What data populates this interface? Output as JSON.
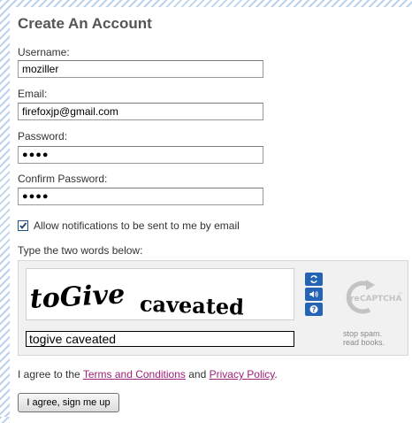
{
  "form": {
    "title": "Create An Account",
    "username_label": "Username:",
    "username_value": "moziller",
    "email_label": "Email:",
    "email_value": "firefoxjp@gmail.com",
    "password_label": "Password:",
    "password_value": "●●●●",
    "confirm_label": "Confirm Password:",
    "confirm_value": "●●●●",
    "notify_label": "Allow notifications to be sent to me by email",
    "notify_checked": true
  },
  "captcha": {
    "prompt": "Type the two words below:",
    "word1": "toGive",
    "word2": "caveated",
    "input_value": "togive caveated",
    "logo_re": "re",
    "logo_text": "CAPTCHA",
    "logo_tm": "™",
    "tagline_1": "stop spam.",
    "tagline_2": "read books.",
    "icons": [
      "refresh-icon",
      "audio-icon",
      "help-icon"
    ]
  },
  "agreement": {
    "prefix": "I agree to the ",
    "terms_link": "Terms and Conditions",
    "middle": " and ",
    "privacy_link": "Privacy Policy",
    "suffix": "."
  },
  "submit": {
    "label": "I agree, sign me up"
  },
  "colors": {
    "link": "#a0207a",
    "recaptcha_button": "#2563b4",
    "stripe": "#bcd3ee"
  }
}
